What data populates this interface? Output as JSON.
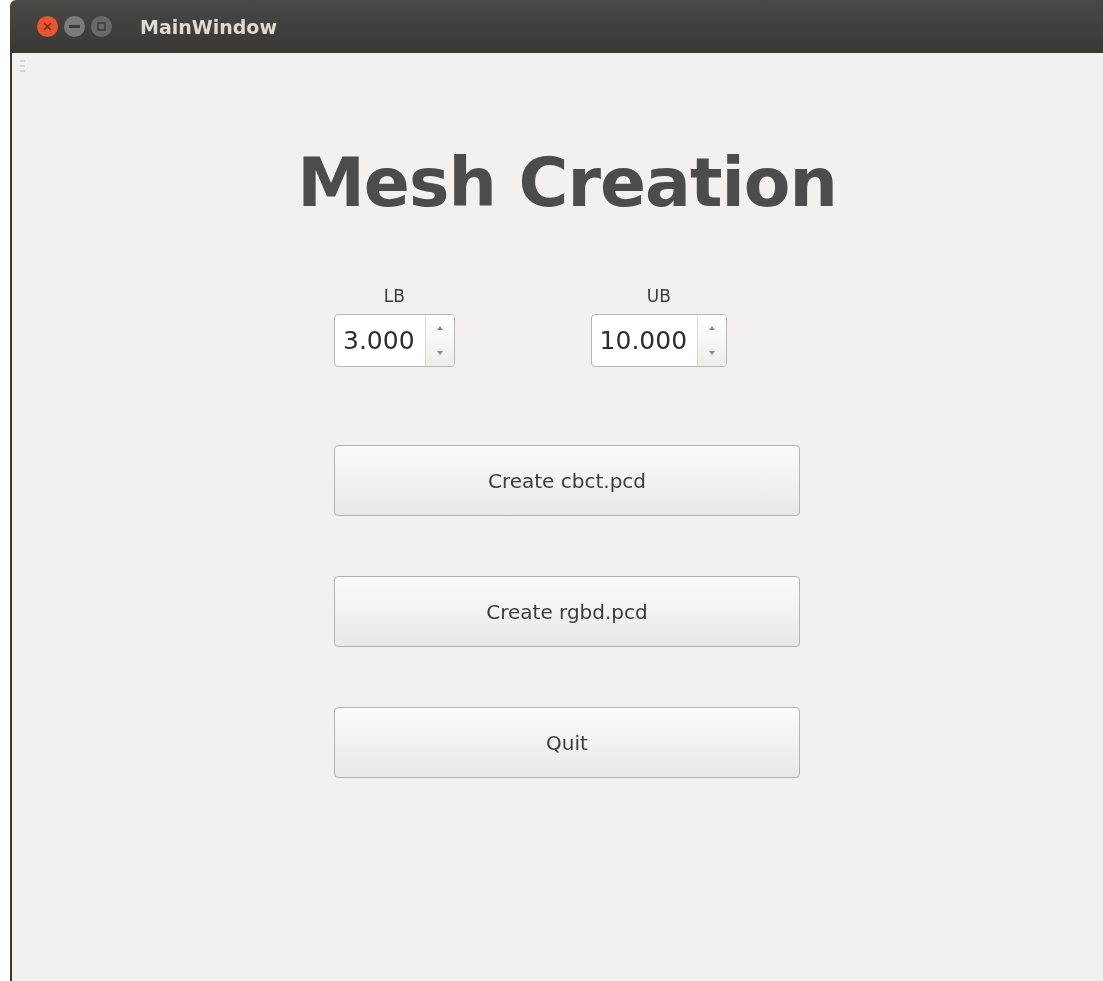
{
  "window": {
    "title": "MainWindow"
  },
  "heading": "Mesh Creation",
  "spinboxes": [
    {
      "label": "LB",
      "value": "3.000"
    },
    {
      "label": "UB",
      "value": "10.000"
    }
  ],
  "buttons": [
    "Create cbct.pcd",
    "Create rgbd.pcd",
    "Quit"
  ]
}
